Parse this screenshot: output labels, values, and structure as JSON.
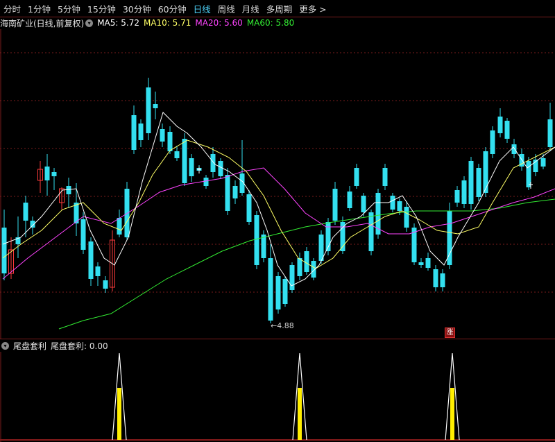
{
  "tabs": [
    {
      "label": "分时",
      "active": false
    },
    {
      "label": "1分钟",
      "active": false
    },
    {
      "label": "5分钟",
      "active": false
    },
    {
      "label": "15分钟",
      "active": false
    },
    {
      "label": "30分钟",
      "active": false
    },
    {
      "label": "60分钟",
      "active": false
    },
    {
      "label": "日线",
      "active": true
    },
    {
      "label": "周线",
      "active": false
    },
    {
      "label": "月线",
      "active": false
    },
    {
      "label": "多周期",
      "active": false
    },
    {
      "label": "更多 >",
      "active": false
    }
  ],
  "legend": {
    "stock": "海南矿业(日线,前复权)",
    "ma5": "MA5: 5.72",
    "ma10": "MA10: 5.71",
    "ma20": "MA20: 5.60",
    "ma60": "MA60: 5.80"
  },
  "indicator": {
    "name": "尾盘套利",
    "value_label": "尾盘套利: 0.00"
  },
  "annotations": {
    "low": "4.88",
    "zhang": "涨"
  },
  "colors": {
    "up": "#ff3b3b",
    "down": "#33e0f0",
    "ma5": "#ffffff",
    "ma10": "#ffff66",
    "ma20": "#ff44ff",
    "ma60": "#33ee33",
    "grid": "#7a1c1c"
  }
}
